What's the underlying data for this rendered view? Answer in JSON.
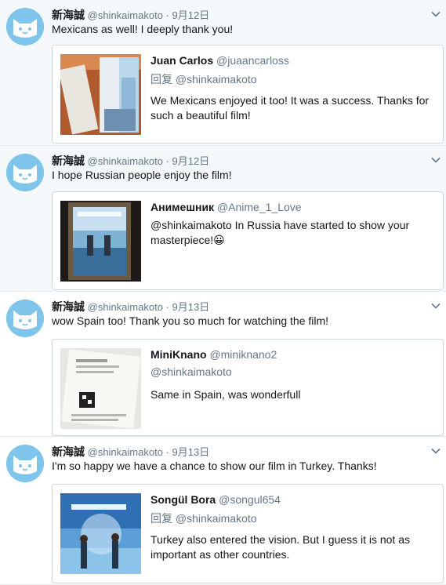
{
  "tweets": [
    {
      "name": "新海誠",
      "handle": "@shinkaimakoto",
      "dot": "·",
      "date": "9月12日",
      "text": "Mexicans as well! I deeply thank you!",
      "quote": {
        "name": "Juan Carlos",
        "handle": "@juaancarloss",
        "reply_prefix": "回复",
        "reply_to": "@shinkaimakoto",
        "text": "We Mexicans enjoyed it too! It was a success. Thanks for such a beautiful film!"
      }
    },
    {
      "name": "新海誠",
      "handle": "@shinkaimakoto",
      "dot": "·",
      "date": "9月12日",
      "text": "I hope Russian people enjoy the film!",
      "quote": {
        "name": "Анимешник",
        "handle": "@Anime_1_Love",
        "text": "@shinkaimakoto In Russia have started to show your masterpiece!😀"
      }
    },
    {
      "name": "新海誠",
      "handle": "@shinkaimakoto",
      "dot": "·",
      "date": "9月13日",
      "text": "wow Spain too! Thank you so much for watching the film!",
      "quote": {
        "name": "MiniKnano",
        "handle": "@miniknano2",
        "reply_prefix": "",
        "reply_to": "@shinkaimakoto",
        "text": "Same in Spain, was wonderfull"
      }
    },
    {
      "name": "新海誠",
      "handle": "@shinkaimakoto",
      "dot": "·",
      "date": "9月13日",
      "text": "I'm so happy we have a chance to show our film in Turkey. Thanks!",
      "quote": {
        "name": "Songül Bora",
        "handle": "@songul654",
        "reply_prefix": "回复",
        "reply_to": "@shinkaimakoto",
        "text": "Turkey also entered the vision. But I guess it is not as important as other countries."
      }
    }
  ],
  "icons": {
    "avatar": "cat-face-icon",
    "menu": "chevron-down-icon"
  },
  "colors": {
    "avatar_bg": "#7fc4ea",
    "meta_text": "#657786",
    "shaded_bg": "#f5f8fa",
    "border": "#ccd6dd"
  }
}
